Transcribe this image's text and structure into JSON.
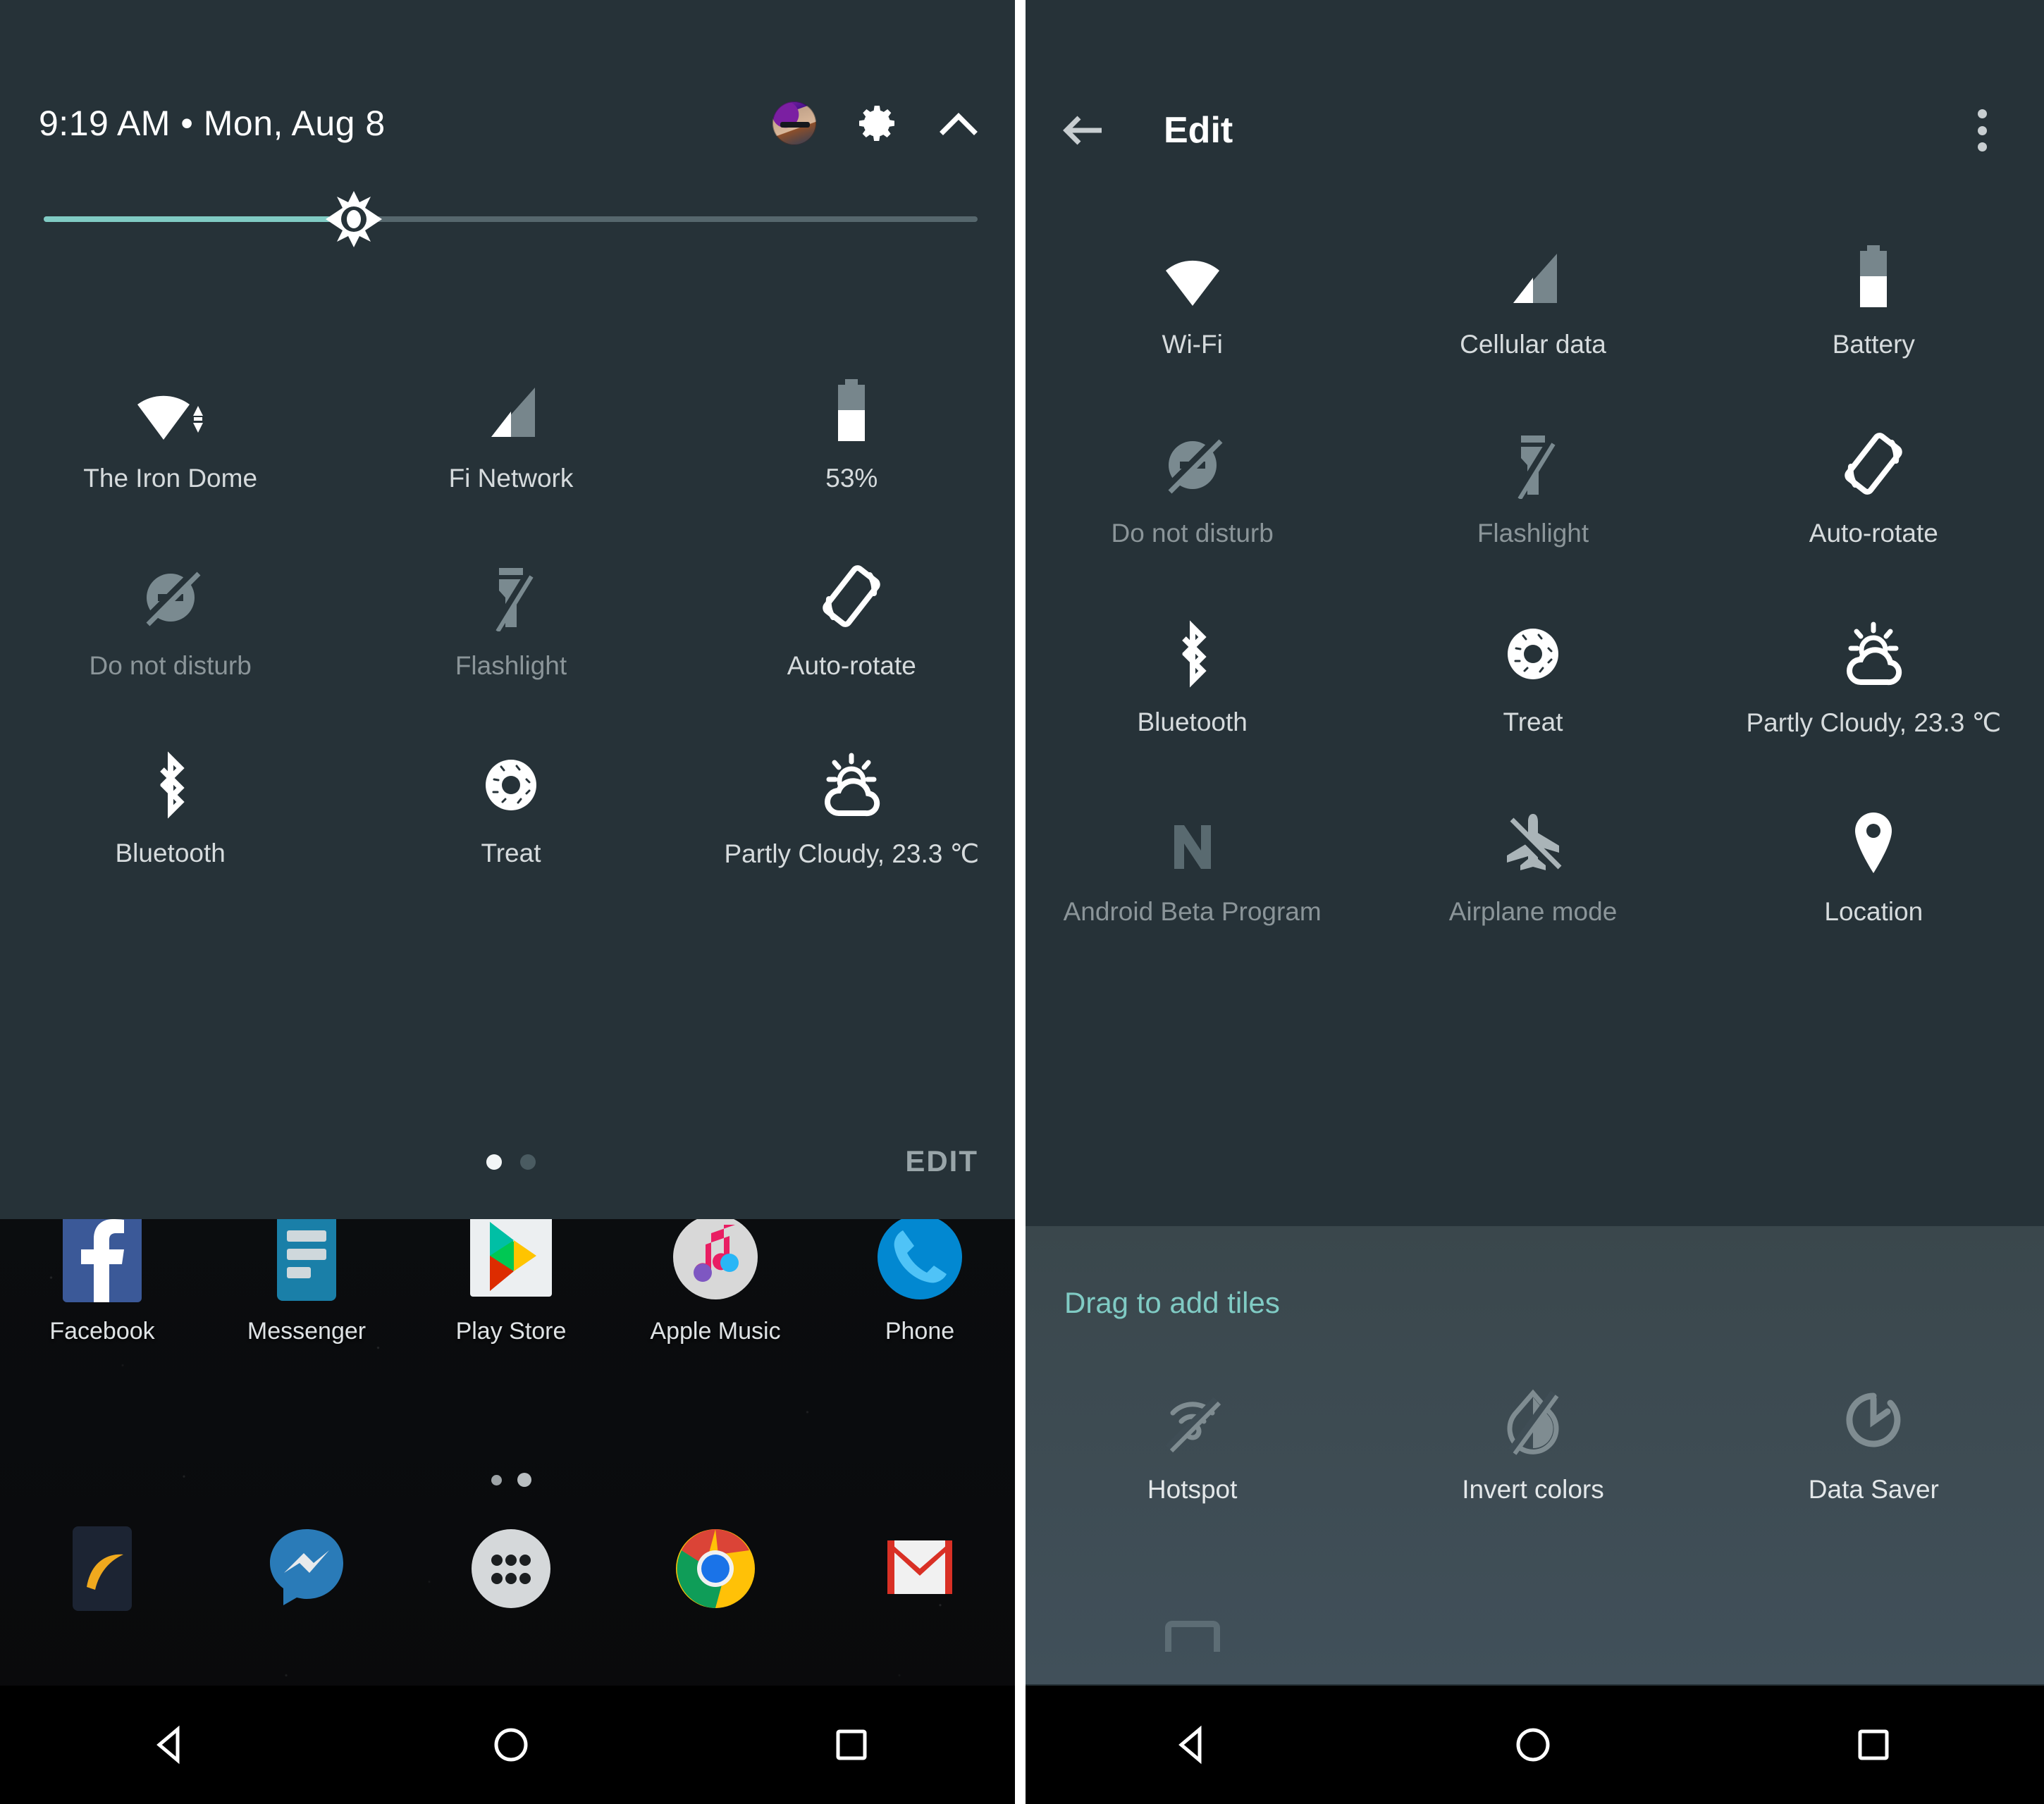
{
  "left_panel": {
    "status_bar": {
      "clock": "9:19 AM  •  Mon, Aug 8",
      "avatar_name": "user-avatar",
      "settings_icon": "gear-icon",
      "collapse_icon": "chevron-up-icon"
    },
    "brightness": {
      "label": "brightness-slider",
      "value_percent": 31
    },
    "tiles": [
      [
        {
          "label": "The Iron Dome",
          "icon": "wifi-icon",
          "state": "on"
        },
        {
          "label": "Fi Network",
          "icon": "cellular-signal-icon",
          "state": "on"
        },
        {
          "label": "53%",
          "icon": "battery-icon",
          "state": "on"
        }
      ],
      [
        {
          "label": "Do not disturb",
          "icon": "do-not-disturb-off-icon",
          "state": "off"
        },
        {
          "label": "Flashlight",
          "icon": "flashlight-off-icon",
          "state": "off"
        },
        {
          "label": "Auto-rotate",
          "icon": "auto-rotate-icon",
          "state": "on"
        }
      ],
      [
        {
          "label": "Bluetooth",
          "icon": "bluetooth-icon",
          "state": "on"
        },
        {
          "label": "Treat",
          "icon": "donut-icon",
          "state": "on"
        },
        {
          "label": "Partly Cloudy, 23.3 ℃",
          "icon": "partly-cloudy-icon",
          "state": "on"
        }
      ]
    ],
    "footer": {
      "edit_label": "EDIT",
      "page_dots": 2,
      "active_page": 1
    },
    "home_screen": {
      "apps": [
        {
          "name": "Facebook",
          "icon": "facebook-icon"
        },
        {
          "name": "Messenger",
          "icon": "messenger-icon"
        },
        {
          "name": "Play Store",
          "icon": "play-store-icon"
        },
        {
          "name": "Apple Music",
          "icon": "apple-music-icon"
        },
        {
          "name": "Phone",
          "icon": "phone-icon"
        }
      ],
      "page_dots": 2,
      "dock": [
        {
          "name": "Nova Launcher",
          "icon": "nova-launcher-icon"
        },
        {
          "name": "Messenger",
          "icon": "messenger-icon"
        },
        {
          "name": "All apps",
          "icon": "app-drawer-icon"
        },
        {
          "name": "Chrome",
          "icon": "chrome-icon"
        },
        {
          "name": "Gmail",
          "icon": "gmail-icon"
        }
      ]
    },
    "nav_bar": [
      {
        "name": "Back",
        "icon": "back-triangle-icon"
      },
      {
        "name": "Home",
        "icon": "home-circle-icon"
      },
      {
        "name": "Recents",
        "icon": "recents-square-icon"
      }
    ]
  },
  "right_panel": {
    "header": {
      "back_icon": "arrow-back-icon",
      "title": "Edit",
      "overflow_icon": "more-vert-icon"
    },
    "active_tiles": [
      [
        {
          "label": "Wi-Fi",
          "icon": "wifi-icon",
          "state": "on"
        },
        {
          "label": "Cellular data",
          "icon": "cellular-signal-icon",
          "state": "on"
        },
        {
          "label": "Battery",
          "icon": "battery-icon",
          "state": "on"
        }
      ],
      [
        {
          "label": "Do not disturb",
          "icon": "do-not-disturb-off-icon",
          "state": "off"
        },
        {
          "label": "Flashlight",
          "icon": "flashlight-off-icon",
          "state": "off"
        },
        {
          "label": "Auto-rotate",
          "icon": "auto-rotate-icon",
          "state": "on"
        }
      ],
      [
        {
          "label": "Bluetooth",
          "icon": "bluetooth-icon",
          "state": "on"
        },
        {
          "label": "Treat",
          "icon": "donut-icon",
          "state": "on"
        },
        {
          "label": "Partly Cloudy, 23.3 ℃",
          "icon": "partly-cloudy-icon",
          "state": "on"
        }
      ],
      [
        {
          "label": "Android Beta Program",
          "icon": "android-n-icon",
          "state": "disabled"
        },
        {
          "label": "Airplane mode",
          "icon": "airplane-off-icon",
          "state": "off"
        },
        {
          "label": "Location",
          "icon": "location-pin-icon",
          "state": "on"
        }
      ]
    ],
    "add_zone": {
      "title": "Drag to add tiles",
      "tiles": [
        {
          "label": "Hotspot",
          "icon": "hotspot-off-icon",
          "state": "off"
        },
        {
          "label": "Invert colors",
          "icon": "invert-colors-off-icon",
          "state": "off"
        },
        {
          "label": "Data Saver",
          "icon": "data-saver-icon",
          "state": "off"
        }
      ]
    },
    "nav_bar": [
      {
        "name": "Back",
        "icon": "back-triangle-icon"
      },
      {
        "name": "Home",
        "icon": "home-circle-icon"
      },
      {
        "name": "Recents",
        "icon": "recents-square-icon"
      }
    ]
  },
  "colors": {
    "shade_background": "#263238",
    "accent_teal": "#80cbc4",
    "tile_on": "#ffffff",
    "tile_off": "#7a8a90",
    "label_text": "#d6dbdd",
    "add_zone_background": "#3f4d55",
    "nav_bar": "#000000"
  }
}
